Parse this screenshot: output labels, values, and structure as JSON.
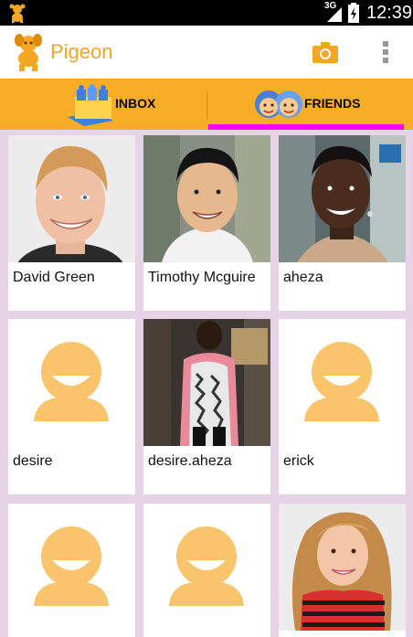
{
  "status_bar": {
    "network": "3G",
    "time": "12:39"
  },
  "app": {
    "title": "Pigeon"
  },
  "tabs": [
    {
      "label": "INBOX",
      "selected": false
    },
    {
      "label": "FRIENDS",
      "selected": true
    }
  ],
  "friends": [
    {
      "name": "David Green",
      "photo": "photo"
    },
    {
      "name": "Timothy Mcguire",
      "photo": "photo"
    },
    {
      "name": "aheza",
      "photo": "photo"
    },
    {
      "name": "desire",
      "photo": "placeholder-avatar"
    },
    {
      "name": "desire.aheza",
      "photo": "photo"
    },
    {
      "name": "erick",
      "photo": "placeholder-avatar"
    },
    {
      "name": "",
      "photo": "placeholder-avatar"
    },
    {
      "name": "",
      "photo": "placeholder-avatar"
    },
    {
      "name": "",
      "photo": "photo"
    }
  ],
  "colors": {
    "accent": "#f7ae26",
    "indicator": "#ff00ff",
    "background": "#e6d3e6",
    "avatar": "#f9c46b"
  }
}
